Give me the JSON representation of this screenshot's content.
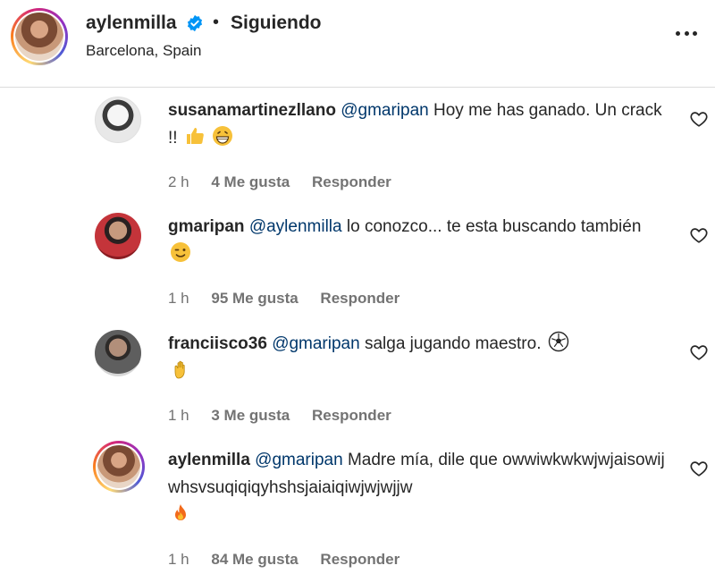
{
  "header": {
    "username": "aylenmilla",
    "separator": "•",
    "follow_state": "Siguiendo",
    "location": "Barcelona, Spain"
  },
  "comments": [
    {
      "username": "susanamartinezllano",
      "mention": "@gmaripan",
      "text": "Hoy me has ganado. Un crack !!",
      "emojis": [
        "thumbs-up-emoji",
        "grinning-face-emoji"
      ],
      "time": "2 h",
      "likes": "4 Me gusta",
      "reply": "Responder"
    },
    {
      "username": "gmaripan",
      "mention": "@aylenmilla",
      "text": "lo conozco... te esta buscando también",
      "emojis": [
        "winking-face-emoji"
      ],
      "time": "1 h",
      "likes": "95 Me gusta",
      "reply": "Responder"
    },
    {
      "username": "franciisco36",
      "mention": "@gmaripan",
      "text": "salga jugando maestro.",
      "emojis": [
        "soccer-ball-emoji",
        "clapping-hands-emoji"
      ],
      "time": "1 h",
      "likes": "3 Me gusta",
      "reply": "Responder"
    },
    {
      "username": "aylenmilla",
      "mention": "@gmaripan",
      "text": "Madre mía, dile que owwiwkwkwjwjaisowijwhsvsuqiqiqyhshsjaiaiqiwjwjwjjw",
      "emojis": [
        "fire-emoji"
      ],
      "time": "1 h",
      "likes": "84 Me gusta",
      "reply": "Responder"
    }
  ],
  "colors": {
    "text": "#262626",
    "meta": "#737373",
    "mention": "#00376b",
    "verified": "#0095f6",
    "divider": "#dbdbdb"
  }
}
